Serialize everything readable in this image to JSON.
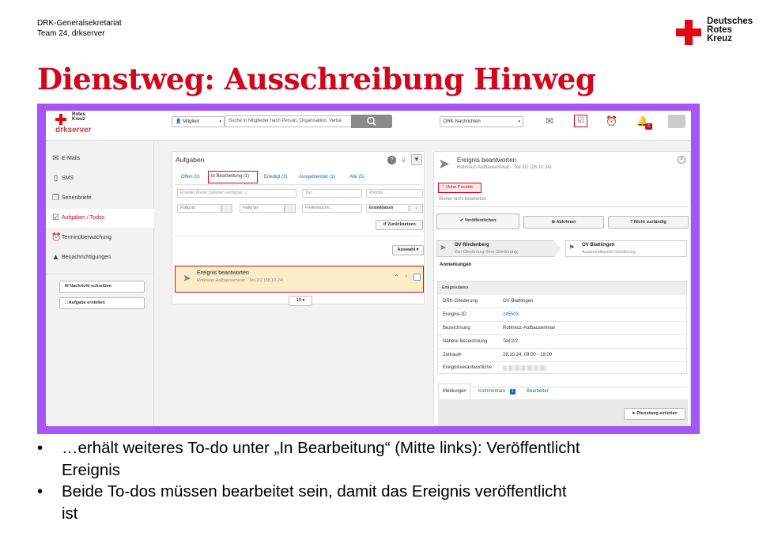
{
  "header": {
    "org_line1": "DRK-Generalsekretariat",
    "org_line2": "Team 24, drkserver"
  },
  "logo": {
    "line1": "Deutsches",
    "line2": "Rotes",
    "line3": "Kreuz"
  },
  "slide_title": "Dienstweg: Ausschreibung Hinweg",
  "app": {
    "logo_line1": "Rotes",
    "logo_line2": "Kreuz",
    "logo_brand": "drkserver",
    "member_select": "Mitglied",
    "search_placeholder": "Suche in Mitglieder nach Person, Organisation, Verba",
    "news_select": "DRK-Nachrichten",
    "notification_count": "6",
    "sidebar": [
      {
        "label": "E-Mails"
      },
      {
        "label": "SMS"
      },
      {
        "label": "Serienbriefe"
      },
      {
        "label": "Aufgaben / Todos"
      },
      {
        "label": "Terminüberwachung"
      },
      {
        "label": "Benachrichtigungen"
      }
    ],
    "side_buttons": {
      "write": "Nachricht schreiben",
      "create": "Aufgabe erstellen"
    },
    "tasks": {
      "title": "Aufgaben",
      "tabs": [
        "Offen (0)",
        "In Bearbeitung (1)",
        "Erledigt (3)",
        "Ausgeblendet (1)",
        "Alle (5)"
      ],
      "creator_placeholder": "Ersteller (Keine Optionen verfügbar...)",
      "type_placeholder": "Typ...",
      "priority_placeholder": "Priorität...",
      "due_from": "Fällig ab",
      "due_to": "Fällig bis",
      "fulltext": "Freitextsuche...",
      "sort": "Erstelldatum",
      "reset": "Zurücksetzen",
      "selection": "Auswahl",
      "item_title": "Ereignis beantworten",
      "item_subtitle": "Rotkreuz-Aufbauseminar - Teil 2/2 (28.10.24)",
      "page_size": "10"
    },
    "detail": {
      "title": "Ereignis beantworten",
      "subtitle": "Rotkreuz-Aufbauseminar - Teil 2/2 (28.10.24)",
      "priority_badge": "Hohe Priorität",
      "status_text": "Bisher nicht bearbeitet",
      "btn_publish": "Veröffentlichen",
      "btn_reject": "Ablehnen",
      "btn_not_responsible": "Nicht zuständig",
      "from_name": "OV Rindenberg",
      "from_sub": "Ziel-Gliederung (Ihre Gliederung)",
      "to_name": "OV Blattlingen",
      "to_sub": "Ausschreibende Gliederung",
      "notes_label": "Anmerkungen",
      "section_label": "Ereignisdaten",
      "rows": [
        {
          "key": "DRK-Gliederung",
          "value": "OV Blattlingen"
        },
        {
          "key": "Ereignis-ID",
          "value": "245503"
        },
        {
          "key": "Bezeichnung",
          "value": "Rotkreuz-Aufbauseminar"
        },
        {
          "key": "Nähere Bezeichnung",
          "value": "Teil 2/2"
        },
        {
          "key": "Zeitraum",
          "value": "28.10.24, 09:00 - 18:00"
        },
        {
          "key": "Ereignisverantwortliche",
          "value": ""
        }
      ],
      "tabs": [
        "Meldungen",
        "Kommentare",
        "Bearbeiter"
      ],
      "comment_count": "1",
      "dienstweg_btn": "Dienstweg einleiten"
    }
  },
  "bullets": [
    {
      "line1": "…erhält weiteres To-do unter „In Bearbeitung“ (Mitte links): Veröffentlicht",
      "line2": "Ereignis"
    },
    {
      "line1": "Beide To-dos müssen bearbeitet sein, damit das Ereignis veröffentlicht",
      "line2": "ist"
    }
  ],
  "colors": {
    "accent": "#d0071f",
    "frame": "#a855f7",
    "highlight": "#fcecc8",
    "link": "#1a6bbf"
  }
}
